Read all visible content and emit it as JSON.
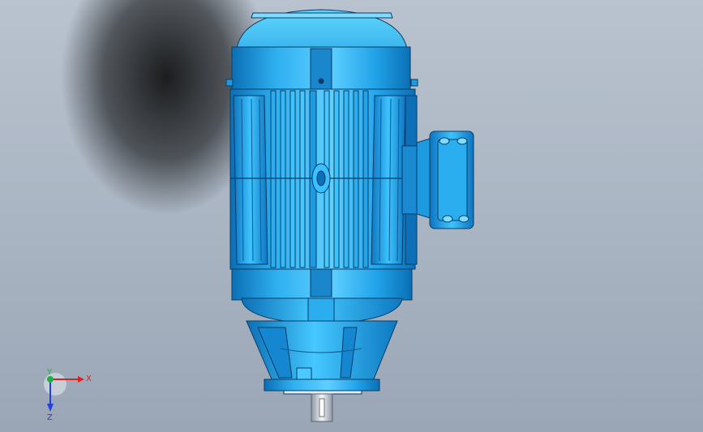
{
  "viewport": {
    "background": "#a9b4c2",
    "model_color": "#1e9be0",
    "model_highlight": "#5fd0ff",
    "model_shadow": "#0b5f9e",
    "edge_color": "#0a3c66",
    "shaft_color": "#d8dde4"
  },
  "triad": {
    "x_label": "X",
    "y_label": "Y",
    "z_label": "Z",
    "x_color": "#e02020",
    "y_color": "#20b040",
    "z_color": "#2040e0"
  }
}
